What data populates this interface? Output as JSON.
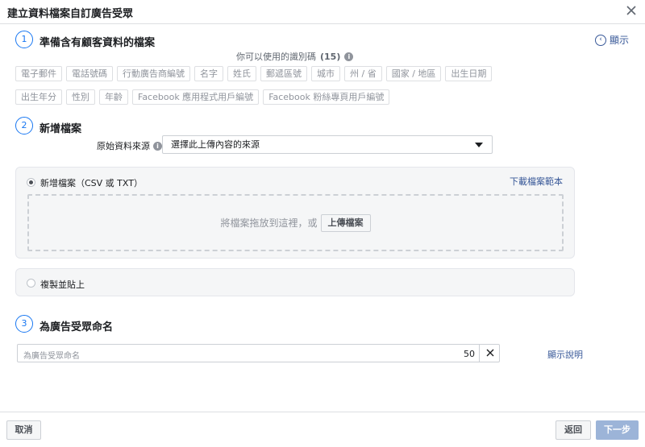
{
  "dialog": {
    "title": "建立資料檔案自訂廣告受眾"
  },
  "step1": {
    "number": "1",
    "title": "準備含有顧客資料的檔案",
    "show_link": "顯示",
    "identifiers_caption": "你可以使用的識別碼",
    "identifiers_count": "(15)",
    "identifiers": [
      "電子郵件",
      "電話號碼",
      "行動廣告商編號",
      "名字",
      "姓氏",
      "郵遞區號",
      "城市",
      "州 / 省",
      "國家 / 地區",
      "出生日期",
      "出生年分",
      "性別",
      "年齡",
      "Facebook 應用程式用戶編號",
      "Facebook 粉絲專頁用戶編號"
    ]
  },
  "step2": {
    "number": "2",
    "title": "新增檔案",
    "source_label": "原始資料來源",
    "source_select": "選擇此上傳內容的來源",
    "add_file_option": "新增檔案（CSV 或 TXT）",
    "download_template": "下載檔案範本",
    "drop_text": "將檔案拖放到這裡，或",
    "upload_button": "上傳檔案",
    "paste_option": "複製並貼上"
  },
  "step3": {
    "number": "3",
    "title": "為廣告受眾命名",
    "name_placeholder": "為廣告受眾命名",
    "char_count": "50",
    "help_link": "顯示說明"
  },
  "footer": {
    "cancel": "取消",
    "back": "返回",
    "next": "下一步"
  },
  "colors": {
    "accent": "#1877f2",
    "link": "#385898",
    "disabled_primary": "#9cb4d8"
  }
}
